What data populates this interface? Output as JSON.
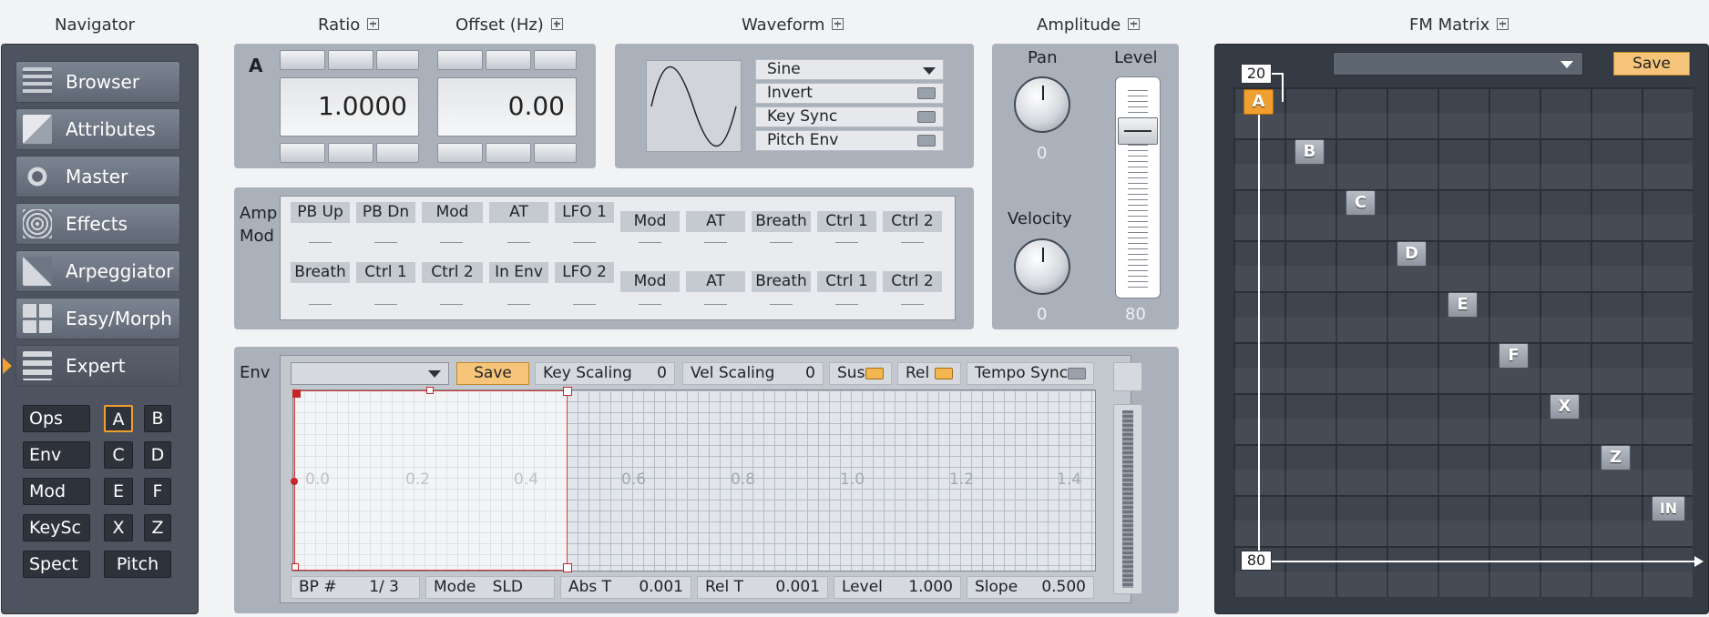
{
  "headers": {
    "navigator": "Navigator",
    "ratio": "Ratio",
    "offset": "Offset (Hz)",
    "waveform": "Waveform",
    "amplitude": "Amplitude",
    "fm_matrix": "FM Matrix"
  },
  "nav": {
    "items": [
      {
        "label": "Browser",
        "icon": "browser-icon"
      },
      {
        "label": "Attributes",
        "icon": "attributes-icon"
      },
      {
        "label": "Master",
        "icon": "master-gear-icon"
      },
      {
        "label": "Effects",
        "icon": "effects-rings-icon"
      },
      {
        "label": "Arpeggiator",
        "icon": "arpeggiator-stairs-icon"
      },
      {
        "label": "Easy/Morph",
        "icon": "easy-morph-cross-icon"
      },
      {
        "label": "Expert",
        "icon": "expert-blocks-icon",
        "active": true
      }
    ],
    "tabs": [
      "Ops",
      "Env",
      "Mod",
      "KeySc",
      "Spect"
    ],
    "ops": [
      "A",
      "B",
      "C",
      "D",
      "E",
      "F",
      "X",
      "Z"
    ],
    "pitch": "Pitch",
    "selected_op": "A"
  },
  "operator": {
    "label": "A",
    "ratio": "1.0000",
    "offset": "0.00"
  },
  "waveform": {
    "shape": "Sine",
    "invert": "Invert",
    "key_sync": "Key Sync",
    "pitch_env": "Pitch Env"
  },
  "amplitude": {
    "pan_label": "Pan",
    "pan_value": "0",
    "velocity_label": "Velocity",
    "velocity_value": "0",
    "level_label": "Level",
    "level_value": "80",
    "level_fraction": 0.8
  },
  "ampmod": {
    "label1": "Amp",
    "label2": "Mod",
    "row1": [
      "PB Up",
      "PB Dn",
      "Mod",
      "AT",
      "LFO 1"
    ],
    "row1b": [
      "Mod",
      "AT",
      "Breath",
      "Ctrl 1",
      "Ctrl 2"
    ],
    "row2": [
      "Breath",
      "Ctrl 1",
      "Ctrl 2",
      "In Env",
      "LFO 2"
    ],
    "row2b": [
      "Mod",
      "AT",
      "Breath",
      "Ctrl 1",
      "Ctrl 2"
    ]
  },
  "env": {
    "label": "Env",
    "save": "Save",
    "key_scaling": "Key Scaling",
    "key_scaling_value": "0",
    "vel_scaling": "Vel Scaling",
    "vel_scaling_value": "0",
    "sus": "Sus",
    "rel": "Rel",
    "tempo_sync": "Tempo Sync",
    "x_ticks": [
      "0.0",
      "0.2",
      "0.4",
      "0.6",
      "0.8",
      "1.0",
      "1.2",
      "1.4"
    ],
    "bp_label": "BP #",
    "bp_value": "1/ 3",
    "mode_label": "Mode",
    "mode_value": "SLD",
    "abs_label": "Abs T",
    "abs_value": "0.001",
    "rel_label": "Rel T",
    "rel_value": "0.001",
    "level_label": "Level",
    "level_value": "1.000",
    "slope_label": "Slope",
    "slope_value": "0.500"
  },
  "fm": {
    "save": "Save",
    "top_value": "20",
    "bottom_value": "80",
    "operators": [
      "A",
      "B",
      "C",
      "D",
      "E",
      "F",
      "X",
      "Z",
      "IN"
    ]
  },
  "colors": {
    "accent": "#f0a030",
    "panel": "#aab1bb",
    "dark": "#4d5460",
    "matrix": "#353b44"
  }
}
